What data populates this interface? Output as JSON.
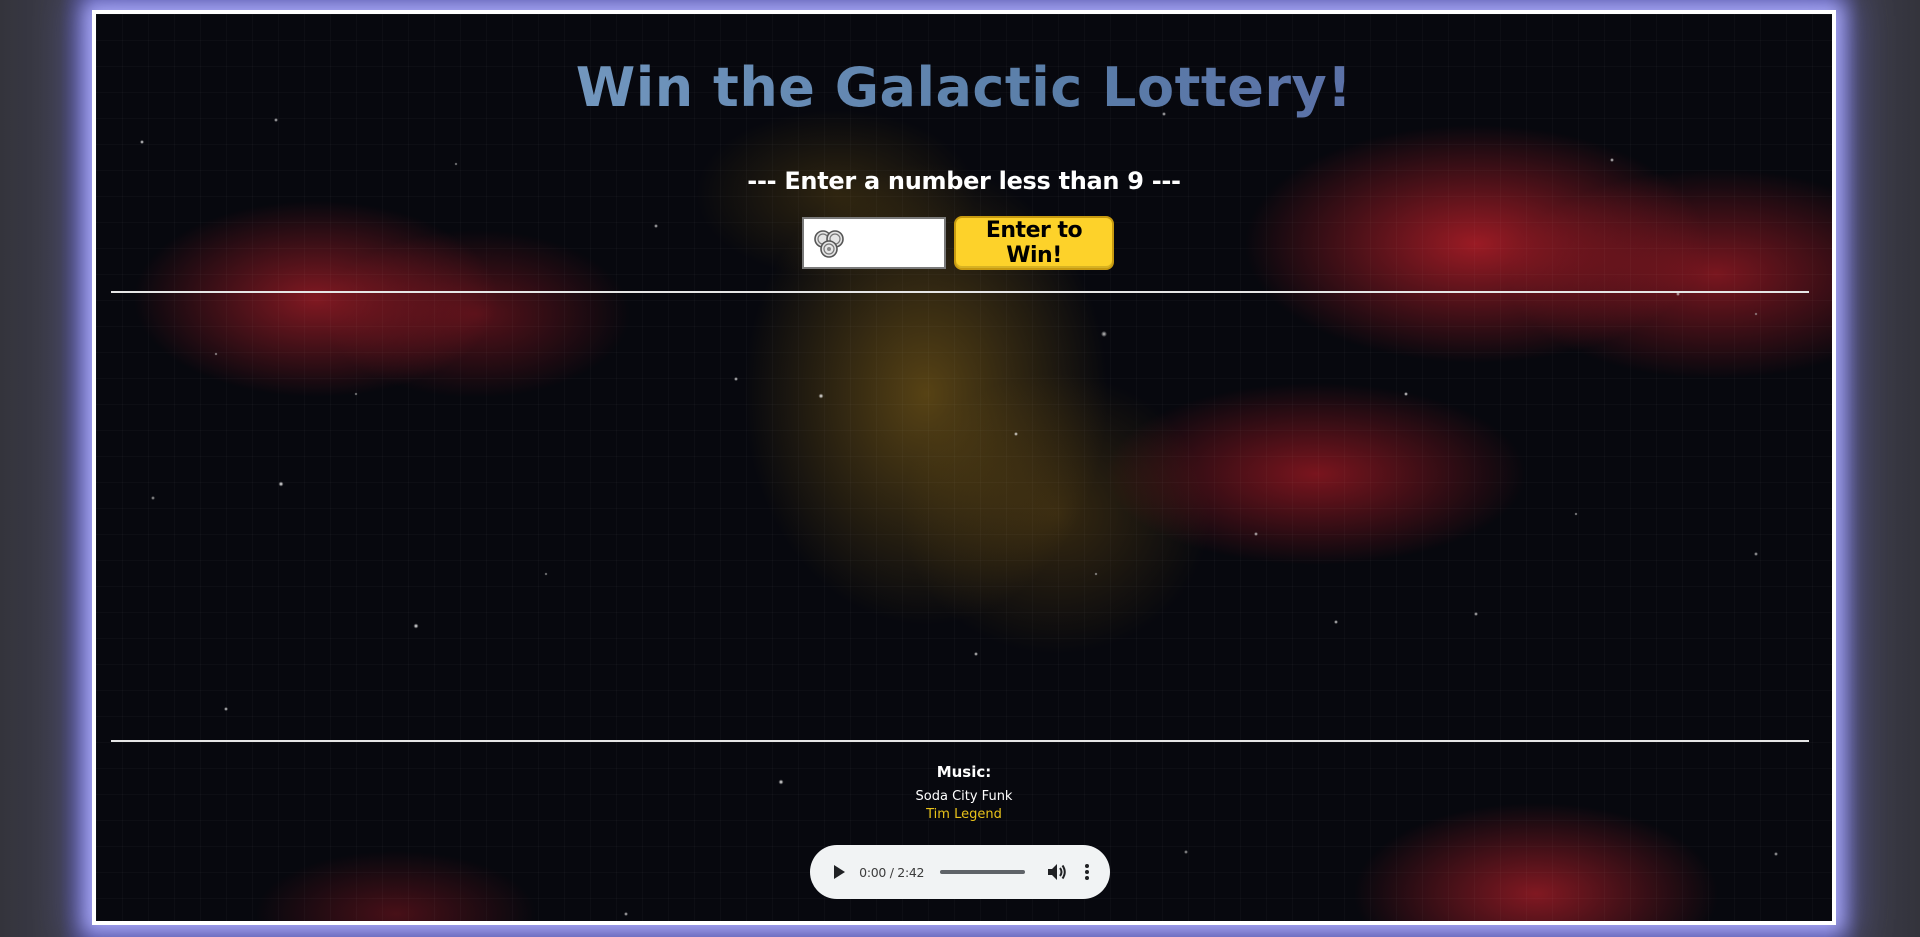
{
  "header": {
    "title": "Win the Galactic Lottery!",
    "subtitle": "--- Enter a number less than 9 ---"
  },
  "entry": {
    "input_value": "",
    "input_icon": "coin-stack-icon",
    "button_label": "Enter to Win!"
  },
  "results": {
    "message": ""
  },
  "music": {
    "heading": "Music:",
    "track_title": "Soda City Funk",
    "artist": "Tim Legend",
    "player": {
      "time": "0:00 / 2:42",
      "play_icon": "play-icon",
      "volume_icon": "volume-icon",
      "more_icon": "more-vertical-icon"
    }
  },
  "colors": {
    "frame_border": "#ffffff",
    "glow": "#4b4b90",
    "button_yellow": "#fdd22a",
    "artist_link": "#e8c21a",
    "title_gradient_start": "#9bb6d0",
    "title_gradient_end": "#5f5aa0"
  }
}
